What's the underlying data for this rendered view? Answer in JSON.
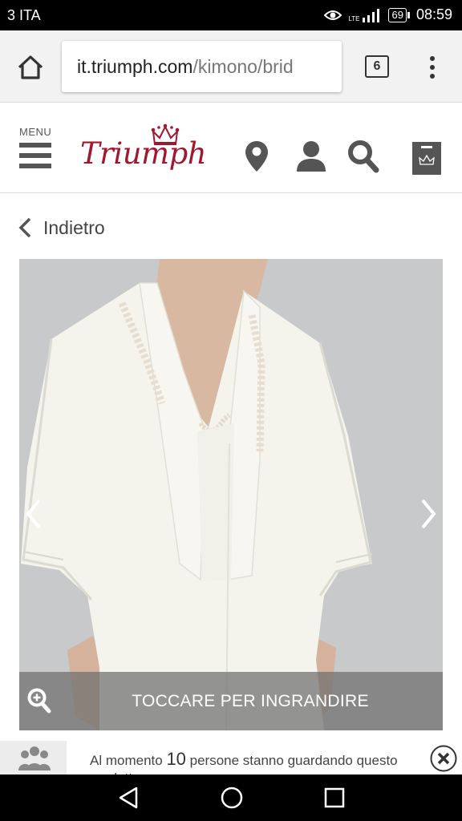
{
  "status_bar": {
    "carrier": "3 ITA",
    "network": "LTE",
    "battery": "69",
    "time": "08:59"
  },
  "browser": {
    "url_host": "it.triumph.com",
    "url_path": "/kimono/brid",
    "tab_count": "6"
  },
  "site_header": {
    "menu_label": "MENU",
    "logo_text": "Triumph",
    "brand_color": "#a0172f",
    "icons": [
      "location-pin-icon",
      "account-icon",
      "search-icon",
      "shopping-bag-icon"
    ]
  },
  "back_link": {
    "label": "Indietro"
  },
  "product_gallery": {
    "zoom_label": "TOCCARE PER INGRANDIRE"
  },
  "notice": {
    "text_before": "Al momento ",
    "count": "10",
    "text_after": " persone stanno guardando questo prodotto"
  }
}
